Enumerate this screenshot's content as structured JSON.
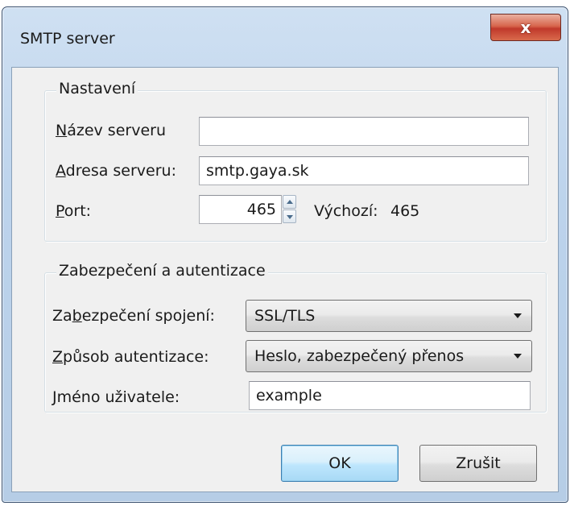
{
  "window": {
    "title": "SMTP server",
    "close_glyph": "x"
  },
  "settings": {
    "legend": "Nastavení",
    "server_name": {
      "label_mnemonic": "N",
      "label_rest": "ázev serveru",
      "value": ""
    },
    "server_address": {
      "label_mnemonic": "A",
      "label_rest": "dresa serveru:",
      "value": "smtp.gaya.sk"
    },
    "port": {
      "label_mnemonic": "P",
      "label_rest": "ort:",
      "value": "465",
      "default_label": "Výchozí:",
      "default_value": "465"
    }
  },
  "security": {
    "legend": "Zabezpečení a autentizace",
    "connection": {
      "label_pre": "Za",
      "label_mnemonic": "b",
      "label_rest": "ezpečení spojení:",
      "value": "SSL/TLS"
    },
    "auth_method": {
      "label_mnemonic": "Z",
      "label_rest": "působ autentizace:",
      "value": "Heslo, zabezpečený přenos"
    },
    "username": {
      "label_mnemonic": "J",
      "label_rest": "méno uživatele:",
      "value": "example"
    }
  },
  "buttons": {
    "ok": "OK",
    "cancel": "Zrušit"
  }
}
